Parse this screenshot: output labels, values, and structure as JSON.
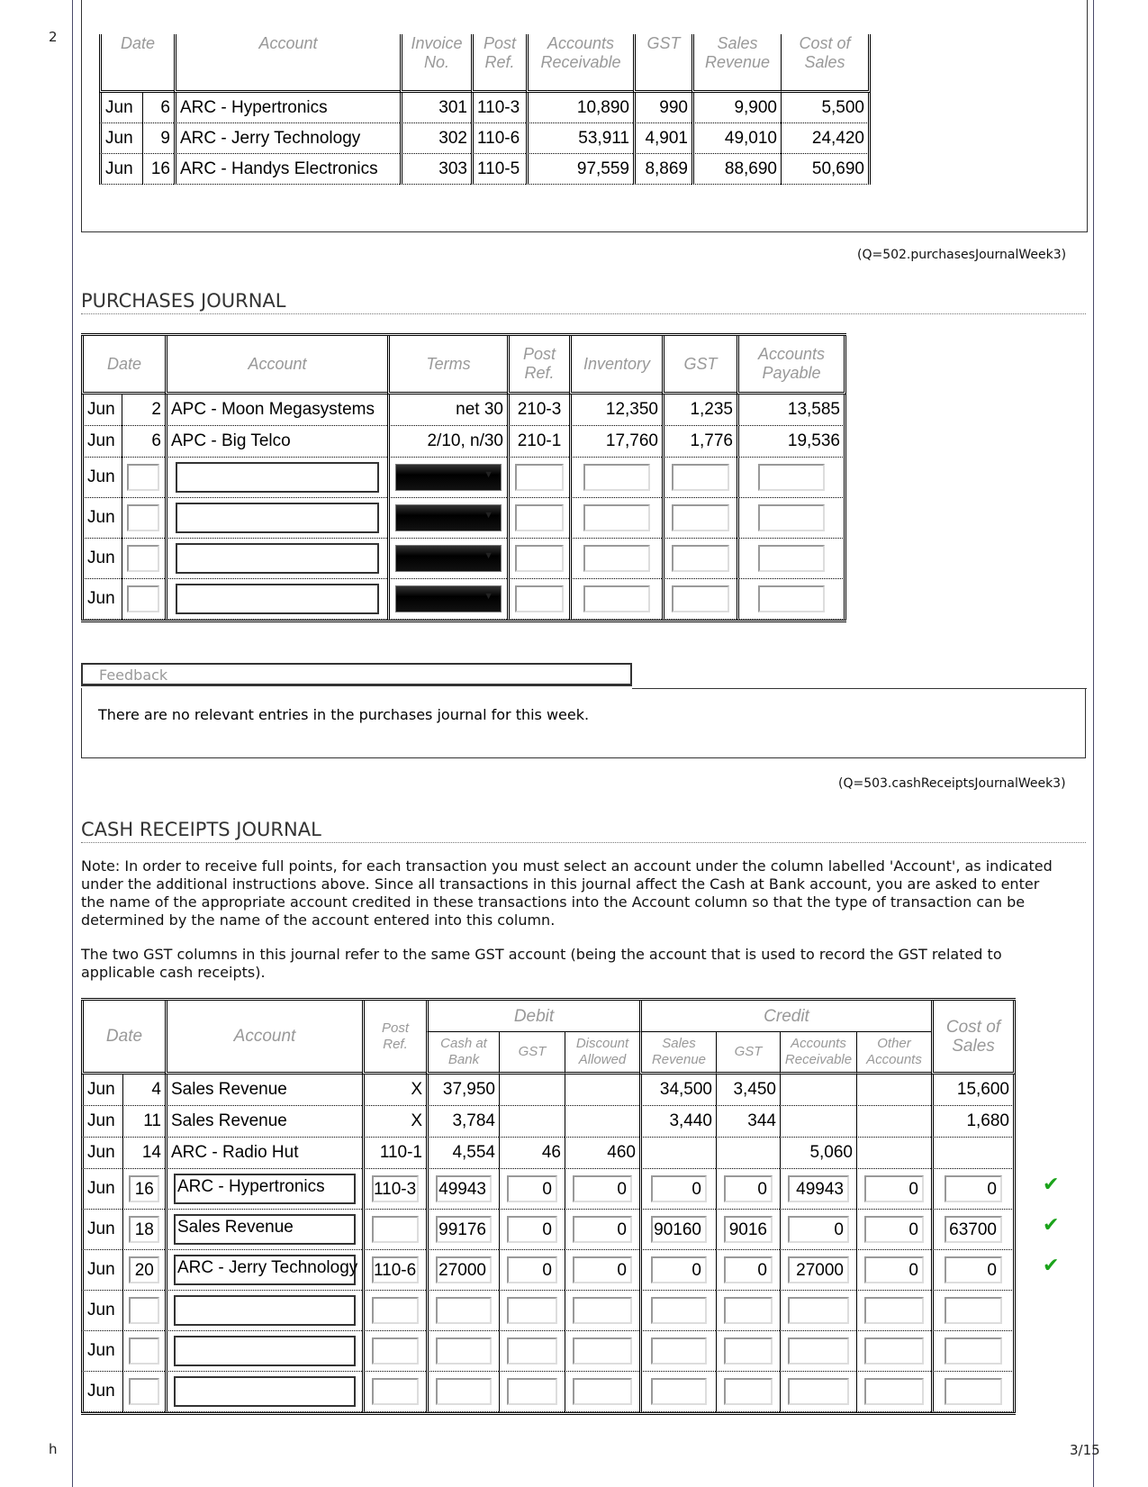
{
  "page": {
    "margin_number": "2",
    "footer_left": "h",
    "page_indicator": "3/15"
  },
  "sales_journal": {
    "headers": [
      "Date",
      "Account",
      "Invoice No.",
      "Post Ref.",
      "Accounts Receivable",
      "GST",
      "Sales Revenue",
      "Cost of Sales"
    ],
    "header_lines": {
      "invoice": [
        "Invoice",
        "No."
      ],
      "post": [
        "Post",
        "Ref."
      ],
      "ar": [
        "Accounts",
        "Receivable"
      ],
      "sales": [
        "Sales",
        "Revenue"
      ],
      "cos": [
        "Cost of",
        "Sales"
      ]
    },
    "rows": [
      {
        "month": "Jun",
        "day": "6",
        "account": "ARC - Hypertronics",
        "invoice": "301",
        "post_ref": "110-3",
        "accounts_receivable": "10,890",
        "gst": "990",
        "sales_revenue": "9,900",
        "cost_of_sales": "5,500"
      },
      {
        "month": "Jun",
        "day": "9",
        "account": "ARC - Jerry Technology",
        "invoice": "302",
        "post_ref": "110-6",
        "accounts_receivable": "53,911",
        "gst": "4,901",
        "sales_revenue": "49,010",
        "cost_of_sales": "24,420"
      },
      {
        "month": "Jun",
        "day": "16",
        "account": "ARC - Handys Electronics",
        "invoice": "303",
        "post_ref": "110-5",
        "accounts_receivable": "97,559",
        "gst": "8,869",
        "sales_revenue": "88,690",
        "cost_of_sales": "50,690"
      }
    ]
  },
  "purchases_ref": "(Q=502.purchasesJournalWeek3)",
  "purchases_journal": {
    "title": "PURCHASES JOURNAL",
    "headers": {
      "date": "Date",
      "account": "Account",
      "terms": "Terms",
      "post": [
        "Post",
        "Ref."
      ],
      "inventory": "Inventory",
      "gst": "GST",
      "ap": [
        "Accounts",
        "Payable"
      ]
    },
    "rows": [
      {
        "month": "Jun",
        "day": "2",
        "account": "APC - Moon Megasystems",
        "terms": "net 30",
        "post_ref": "210-3",
        "inventory": "12,350",
        "gst": "1,235",
        "accounts_payable": "13,585"
      },
      {
        "month": "Jun",
        "day": "6",
        "account": "APC - Big Telco",
        "terms": "2/10, n/30",
        "post_ref": "210-1",
        "inventory": "17,760",
        "gst": "1,776",
        "accounts_payable": "19,536"
      }
    ],
    "input_rows": [
      {
        "month": "Jun",
        "day": "",
        "account": "",
        "terms": "",
        "post_ref": "",
        "inventory": "",
        "gst": "",
        "accounts_payable": ""
      },
      {
        "month": "Jun",
        "day": "",
        "account": "",
        "terms": "",
        "post_ref": "",
        "inventory": "",
        "gst": "",
        "accounts_payable": ""
      },
      {
        "month": "Jun",
        "day": "",
        "account": "",
        "terms": "",
        "post_ref": "",
        "inventory": "",
        "gst": "",
        "accounts_payable": ""
      },
      {
        "month": "Jun",
        "day": "",
        "account": "",
        "terms": "",
        "post_ref": "",
        "inventory": "",
        "gst": "",
        "accounts_payable": ""
      }
    ]
  },
  "feedback": {
    "label": "Feedback",
    "text": "There are no relevant entries in the purchases journal for this week."
  },
  "cash_ref": "(Q=503.cashReceiptsJournalWeek3)",
  "cash_receipts_journal": {
    "title": "CASH RECEIPTS JOURNAL",
    "note1": "Note: In order to receive full points, for each transaction you must select an account under the column labelled 'Account', as indicated under the additional instructions above. Since all transactions in this journal affect the Cash at Bank account, you are asked to enter the name of the appropriate account credited in these transactions into the Account column so that the type of transaction can be determined by the name of the account entered into this column.",
    "note2": "The two GST columns in this journal refer to the same GST account (being the account that is used to record the GST related to applicable cash receipts).",
    "headers": {
      "date": "Date",
      "account": "Account",
      "post": [
        "Post",
        "Ref."
      ],
      "debit": "Debit",
      "credit": "Credit",
      "cash": [
        "Cash at",
        "Bank"
      ],
      "dgst": "GST",
      "disc": [
        "Discount",
        "Allowed"
      ],
      "sales": [
        "Sales",
        "Revenue"
      ],
      "cgst": "GST",
      "ar": [
        "Accounts",
        "Receivable"
      ],
      "other": [
        "Other",
        "Accounts"
      ],
      "cos": [
        "Cost of",
        "Sales"
      ]
    },
    "rows": [
      {
        "month": "Jun",
        "day": "4",
        "account": "Sales Revenue",
        "post_ref": "X",
        "cash": "37,950",
        "dgst": "",
        "discount": "",
        "sales": "34,500",
        "cgst": "3,450",
        "ar": "",
        "other": "",
        "cos": "15,600"
      },
      {
        "month": "Jun",
        "day": "11",
        "account": "Sales Revenue",
        "post_ref": "X",
        "cash": "3,784",
        "dgst": "",
        "discount": "",
        "sales": "3,440",
        "cgst": "344",
        "ar": "",
        "other": "",
        "cos": "1,680"
      },
      {
        "month": "Jun",
        "day": "14",
        "account": "ARC - Radio Hut",
        "post_ref": "110-1",
        "cash": "4,554",
        "dgst": "46",
        "discount": "460",
        "sales": "",
        "cgst": "",
        "ar": "5,060",
        "other": "",
        "cos": ""
      }
    ],
    "input_rows": [
      {
        "month": "Jun",
        "day": "16",
        "account": "ARC - Hypertronics",
        "post_ref": "110-3",
        "cash": "49943",
        "dgst": "0",
        "discount": "0",
        "sales": "0",
        "cgst": "0",
        "ar": "49943",
        "other": "0",
        "cos": "0",
        "status": "correct"
      },
      {
        "month": "Jun",
        "day": "18",
        "account": "Sales Revenue",
        "post_ref": "",
        "cash": "99176",
        "dgst": "0",
        "discount": "0",
        "sales": "90160",
        "cgst": "9016",
        "ar": "0",
        "other": "0",
        "cos": "63700",
        "status": "correct"
      },
      {
        "month": "Jun",
        "day": "20",
        "account": "ARC - Jerry Technology",
        "post_ref": "110-6",
        "cash": "27000",
        "dgst": "0",
        "discount": "0",
        "sales": "0",
        "cgst": "0",
        "ar": "27000",
        "other": "0",
        "cos": "0",
        "status": "correct"
      },
      {
        "month": "Jun",
        "day": "",
        "account": "",
        "post_ref": "",
        "cash": "",
        "dgst": "",
        "discount": "",
        "sales": "",
        "cgst": "",
        "ar": "",
        "other": "",
        "cos": "",
        "status": ""
      },
      {
        "month": "Jun",
        "day": "",
        "account": "",
        "post_ref": "",
        "cash": "",
        "dgst": "",
        "discount": "",
        "sales": "",
        "cgst": "",
        "ar": "",
        "other": "",
        "cos": "",
        "status": ""
      },
      {
        "month": "Jun",
        "day": "",
        "account": "",
        "post_ref": "",
        "cash": "",
        "dgst": "",
        "discount": "",
        "sales": "",
        "cgst": "",
        "ar": "",
        "other": "",
        "cos": "",
        "status": ""
      }
    ],
    "check_glyph": "✔",
    "check_color": "#1aa31a"
  }
}
